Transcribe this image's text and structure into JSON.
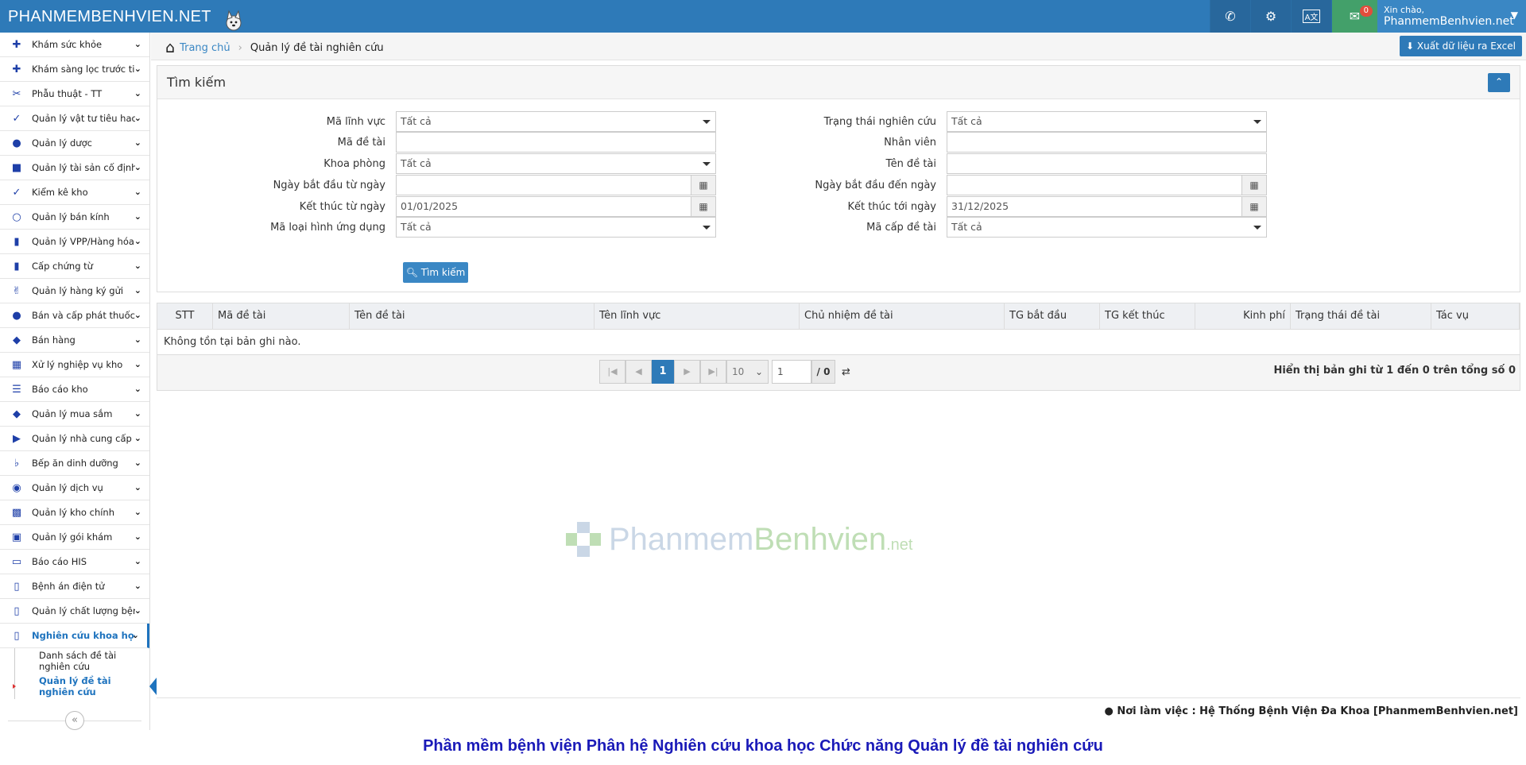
{
  "header": {
    "brand": "PHANMEMBENHVIEN.NET",
    "greeting": "Xin chào,",
    "username": "PhanmemBenhvien.net",
    "mail_count": "0",
    "icons": [
      "phone-icon",
      "settings-icon",
      "language-icon",
      "mail-icon"
    ]
  },
  "sidebar": {
    "items": [
      {
        "label": "Khám sức khỏe",
        "icon": "medkit-icon"
      },
      {
        "label": "Khám sàng lọc trước tiêm",
        "icon": "medkit-icon"
      },
      {
        "label": "Phẫu thuật - TT",
        "icon": "scissors-icon"
      },
      {
        "label": "Quản lý vật tư tiêu hao",
        "icon": "syringe-icon"
      },
      {
        "label": "Quản lý dược",
        "icon": "pills-icon"
      },
      {
        "label": "Quản lý tài sản cố định",
        "icon": "cubes-icon"
      },
      {
        "label": "Kiểm kê kho",
        "icon": "checklist-icon"
      },
      {
        "label": "Quản lý bán kính",
        "icon": "glasses-icon"
      },
      {
        "label": "Quản lý VPP/Hàng hóa",
        "icon": "book-icon"
      },
      {
        "label": "Cấp chứng từ",
        "icon": "book-icon"
      },
      {
        "label": "Quản lý hàng ký gửi",
        "icon": "handshake-icon"
      },
      {
        "label": "Bán và cấp phát thuốc",
        "icon": "pills-icon"
      },
      {
        "label": "Bán hàng",
        "icon": "cart-icon"
      },
      {
        "label": "Xử lý nghiệp vụ kho",
        "icon": "store-icon"
      },
      {
        "label": "Báo cáo kho",
        "icon": "list-icon"
      },
      {
        "label": "Quản lý mua sắm",
        "icon": "cart-icon"
      },
      {
        "label": "Quản lý nhà cung cấp",
        "icon": "truck-icon"
      },
      {
        "label": "Bếp ăn dinh dưỡng",
        "icon": "utensils-icon"
      },
      {
        "label": "Quản lý dịch vụ",
        "icon": "service-icon"
      },
      {
        "label": "Quản lý kho chính",
        "icon": "chart-icon"
      },
      {
        "label": "Quản lý gói khám",
        "icon": "box-icon"
      },
      {
        "label": "Báo cáo HIS",
        "icon": "folder-icon"
      },
      {
        "label": "Bệnh án điện tử",
        "icon": "record-icon"
      },
      {
        "label": "Quản lý chất lượng bệnh",
        "icon": "record-icon"
      },
      {
        "label": "Nghiên cứu khoa học",
        "icon": "record-icon"
      }
    ],
    "subitems": [
      {
        "label": "Danh sách đề tài nghiên cứu"
      },
      {
        "label": "Quản lý đề tài nghiên cứu"
      }
    ]
  },
  "breadcrumb": {
    "home": "Trang chủ",
    "current": "Quản lý đề tài nghiên cứu"
  },
  "toolbar": {
    "excel_label": "Xuất dữ liệu ra Excel"
  },
  "search": {
    "title": "Tìm kiếm",
    "button_label": "Tìm kiếm",
    "left": [
      {
        "label": "Mã lĩnh vực",
        "value": "Tất cả",
        "type": "select"
      },
      {
        "label": "Mã đề tài",
        "value": "",
        "type": "text"
      },
      {
        "label": "Khoa phòng",
        "value": "Tất cả",
        "type": "select"
      },
      {
        "label": "Ngày bắt đầu từ ngày",
        "value": "",
        "type": "date"
      },
      {
        "label": "Kết thúc từ ngày",
        "value": "01/01/2025",
        "type": "date"
      },
      {
        "label": "Mã loại hình ứng dụng",
        "value": "Tất cả",
        "type": "select"
      }
    ],
    "right": [
      {
        "label": "Trạng thái nghiên cứu",
        "value": "Tất cả",
        "type": "select"
      },
      {
        "label": "Nhân viên",
        "value": "",
        "type": "text"
      },
      {
        "label": "Tên đề tài",
        "value": "",
        "type": "text"
      },
      {
        "label": "Ngày bắt đầu đến ngày",
        "value": "",
        "type": "date"
      },
      {
        "label": "Kết thúc tới ngày",
        "value": "31/12/2025",
        "type": "date"
      },
      {
        "label": "Mã cấp đề tài",
        "value": "Tất cả",
        "type": "select"
      }
    ]
  },
  "table": {
    "columns": [
      "STT",
      "Mã đề tài",
      "Tên đề tài",
      "Tên lĩnh vực",
      "Chủ nhiệm đề tài",
      "TG bắt đầu",
      "TG kết thúc",
      "Kinh phí",
      "Trạng thái đề tài",
      "Tác vụ"
    ],
    "empty_text": "Không tồn tại bản ghi nào.",
    "pager": {
      "page": "1",
      "page_size": "10",
      "page_input": "1",
      "total_pages": "/ 0"
    },
    "info": "Hiển thị bản ghi từ 1 đến 0 trên tổng số 0"
  },
  "watermark": {
    "part1": "Phanmem",
    "part2": "Benhvien",
    "part3": ".net"
  },
  "footer": {
    "workplace": "Nơi làm việc : Hệ Thống Bệnh Viện Đa Khoa [PhanmemBenhvien.net]"
  },
  "caption": "Phần mềm bệnh viện Phân hệ Nghiên cứu khoa học Chức năng Quản lý đề tài nghiên cứu",
  "colors": {
    "primary": "#2e7ab8",
    "mail": "#43a06a",
    "caption": "#1a1ab8"
  }
}
